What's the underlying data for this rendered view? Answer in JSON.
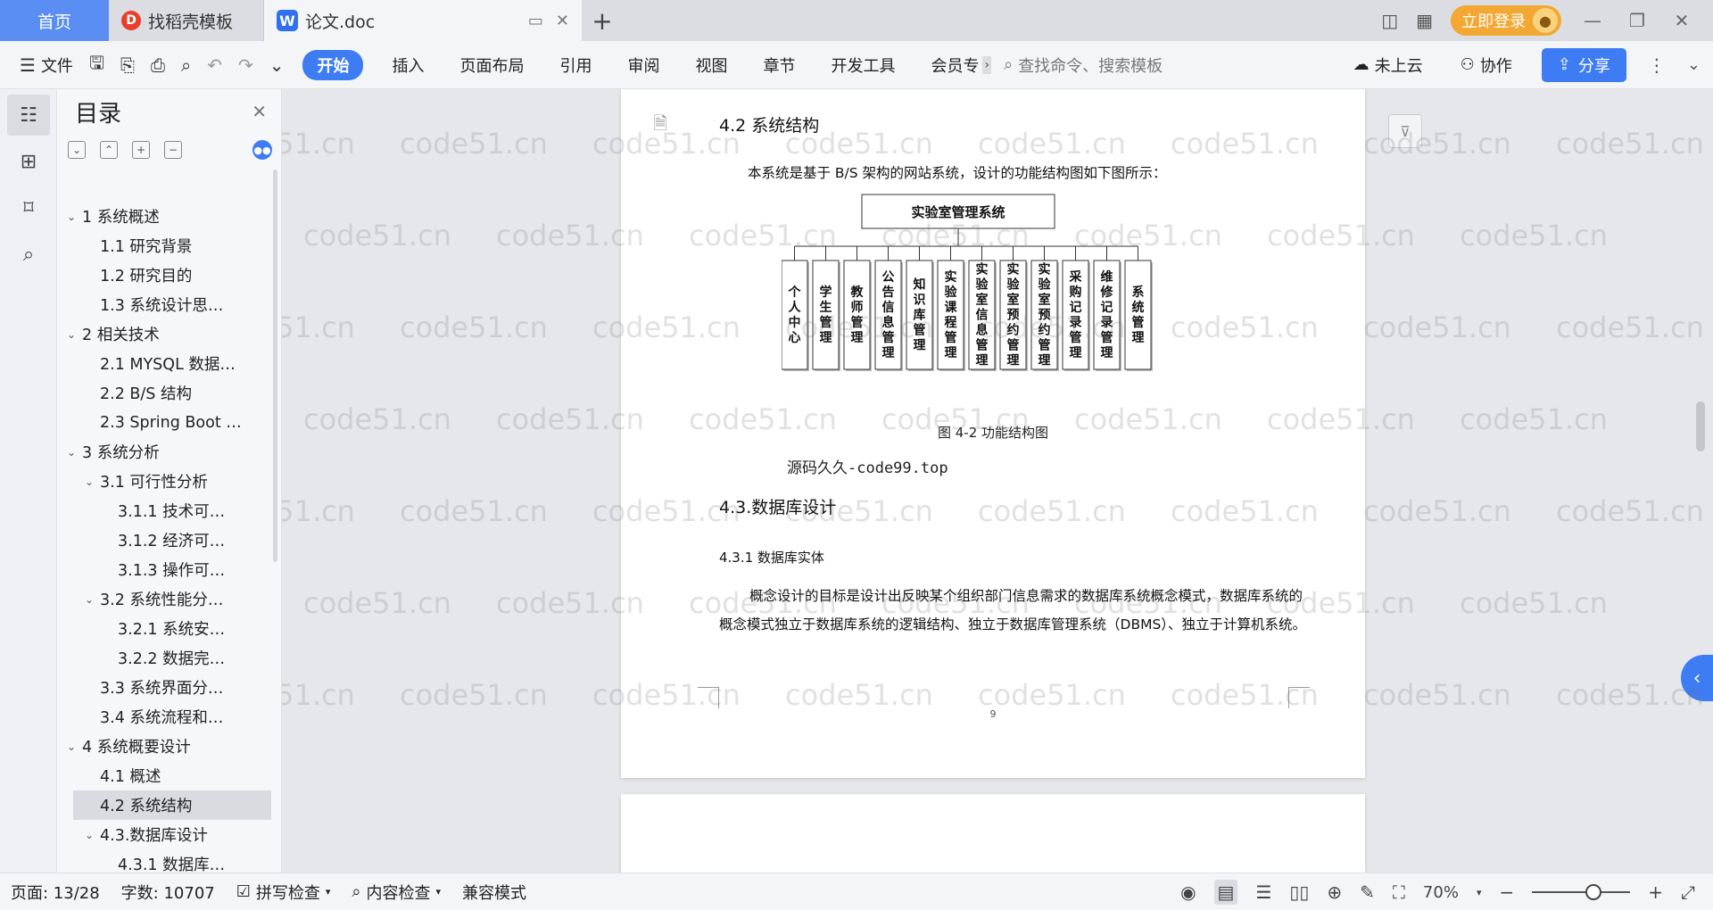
{
  "titlebar": {
    "home_tab": "首页",
    "tab2": "找稻壳模板",
    "tab3": "论文.doc",
    "login": "立即登录"
  },
  "toolbar": {
    "file": "文件",
    "start": "开始",
    "menus": [
      "插入",
      "页面布局",
      "引用",
      "审阅",
      "视图",
      "章节",
      "开发工具",
      "会员专"
    ],
    "search_placeholder": "查找命令、搜索模板",
    "cloud": "未上云",
    "collab": "协作",
    "share": "分享"
  },
  "toc": {
    "title": "目录",
    "items": [
      {
        "label": "1 系统概述",
        "level": 1,
        "caret": "expanded"
      },
      {
        "label": "1.1  研究背景",
        "level": 2,
        "caret": "none"
      },
      {
        "label": "1.2 研究目的",
        "level": 2,
        "caret": "none"
      },
      {
        "label": "1.3 系统设计思…",
        "level": 2,
        "caret": "none"
      },
      {
        "label": "2 相关技术",
        "level": 1,
        "caret": "expanded"
      },
      {
        "label": "2.1 MYSQL 数据…",
        "level": 2,
        "caret": "none"
      },
      {
        "label": "2.2 B/S 结构",
        "level": 2,
        "caret": "none"
      },
      {
        "label": "2.3 Spring Boot …",
        "level": 2,
        "caret": "none"
      },
      {
        "label": "3 系统分析",
        "level": 1,
        "caret": "expanded"
      },
      {
        "label": "3.1 可行性分析",
        "level": 2,
        "caret": "expanded"
      },
      {
        "label": "3.1.1 技术可…",
        "level": 3,
        "caret": "none"
      },
      {
        "label": "3.1.2 经济可…",
        "level": 3,
        "caret": "none"
      },
      {
        "label": "3.1.3 操作可…",
        "level": 3,
        "caret": "none"
      },
      {
        "label": "3.2 系统性能分…",
        "level": 2,
        "caret": "expanded"
      },
      {
        "label": "3.2.1  系统安…",
        "level": 3,
        "caret": "none"
      },
      {
        "label": "3.2.2  数据完…",
        "level": 3,
        "caret": "none"
      },
      {
        "label": "3.3 系统界面分…",
        "level": 2,
        "caret": "none"
      },
      {
        "label": "3.4 系统流程和…",
        "level": 2,
        "caret": "none"
      },
      {
        "label": "4 系统概要设计",
        "level": 1,
        "caret": "expanded"
      },
      {
        "label": "4.1 概述",
        "level": 2,
        "caret": "none"
      },
      {
        "label": "4.2 系统结构",
        "level": 2,
        "caret": "none",
        "selected": true
      },
      {
        "label": "4.3.数据库设计",
        "level": 2,
        "caret": "expanded"
      },
      {
        "label": "4.3.1 数据库…",
        "level": 3,
        "caret": "none"
      }
    ]
  },
  "doc": {
    "heading_42": "4.2 系统结构",
    "para1": "本系统是基于 B/S 架构的网站系统，设计的功能结构图如下图所示：",
    "diagram_root": "实验室管理系统",
    "diagram_children": [
      "个人中心",
      "学生管理",
      "教师管理",
      "公告信息管理",
      "知识库管理",
      "实验课程管理",
      "实验室信息管理",
      "实验室预约管理",
      "实验室预约管理",
      "采购记录管理",
      "维修记录管理",
      "系统管理"
    ],
    "caption": "图 4-2 功能结构图",
    "source_note": "源码久久-code99.top",
    "heading_43": "4.3.数据库设计",
    "heading_431": "4.3.1 数据库实体",
    "para2": "概念设计的目标是设计出反映某个组织部门信息需求的数据库系统概念模式，数据库系统的概念模式独立于数据库系统的逻辑结构、独立于数据库管理系统（DBMS）、独立于计算机系统。",
    "page_number": "9",
    "watermark": "code51.cn"
  },
  "status": {
    "page": "页面: 13/28",
    "words": "字数: 10707",
    "spell": "拼写检查",
    "content_check": "内容检查",
    "compat": "兼容模式",
    "zoom": "70%"
  },
  "colors": {
    "accent": "#3e7cf4",
    "login": "#f2a833"
  }
}
